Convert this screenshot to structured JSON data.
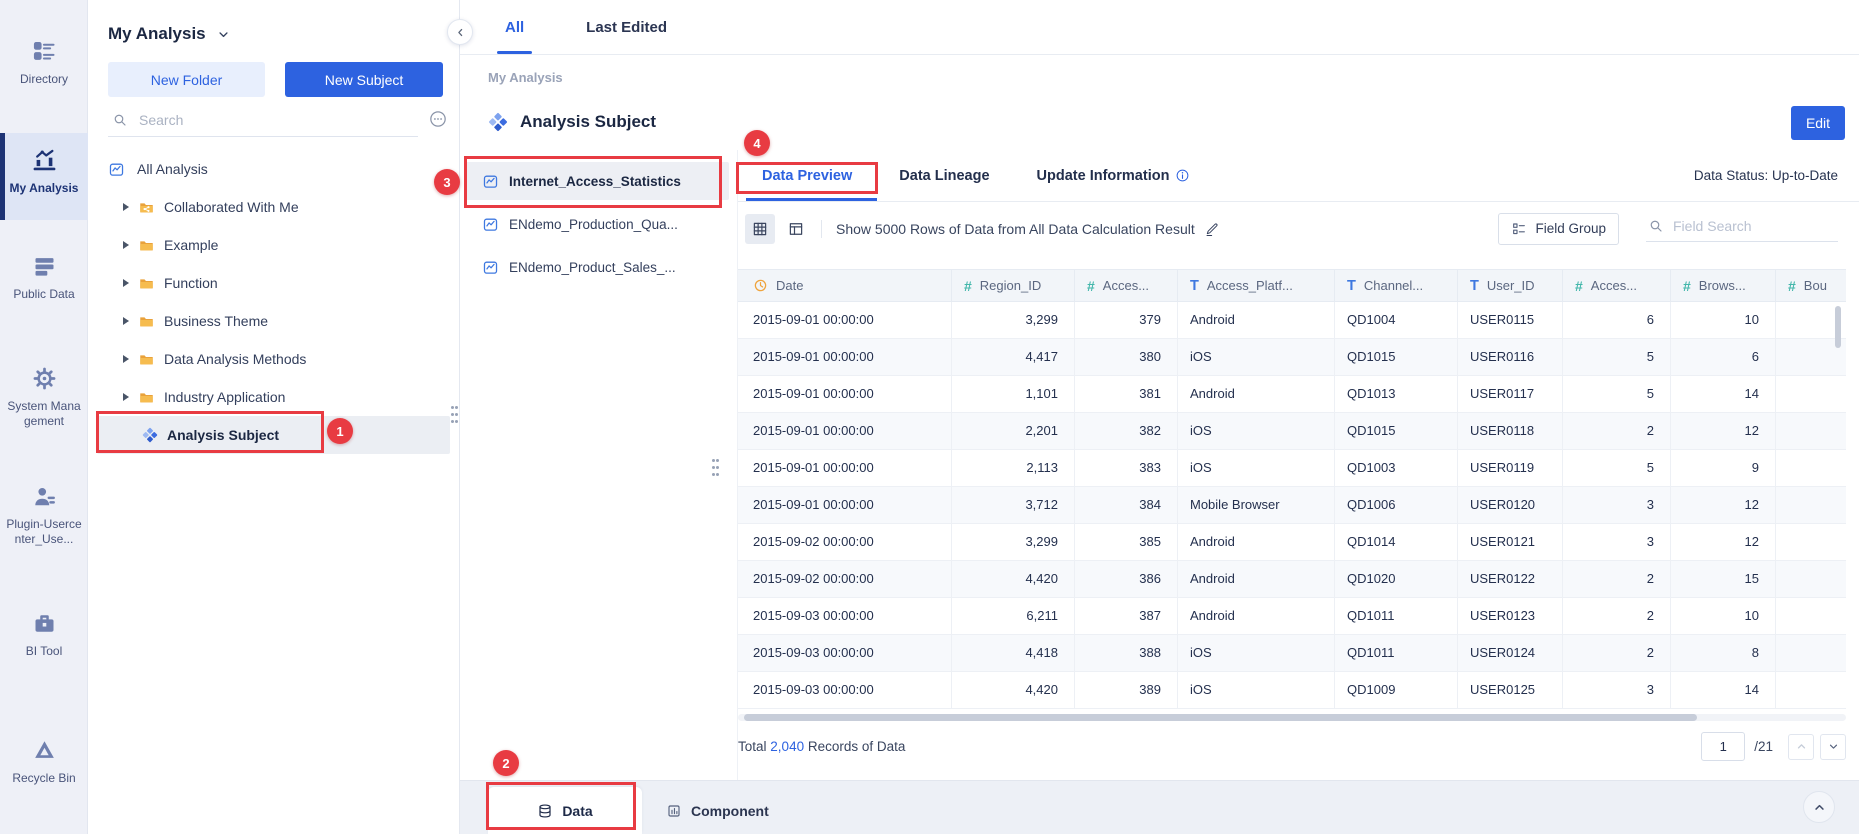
{
  "colors": {
    "accent": "#2d62e0",
    "annotation_red": "#e83b42",
    "sidebar_active_navy": "#1d3375",
    "folder_yellow": "#f3b74a",
    "numeric_field_teal": "#44b7ab",
    "text_field_blue": "#3e78e0",
    "date_field_orange": "#efa43d"
  },
  "annotations": {
    "step1": "1",
    "step2": "2",
    "step3": "3",
    "step4": "4"
  },
  "sidebar": {
    "items": [
      {
        "label": "Directory",
        "icon": "directory-icon",
        "active": false
      },
      {
        "label": "My Analysis",
        "icon": "my-analysis-icon",
        "active": true
      },
      {
        "label": "Public Data",
        "icon": "public-data-icon",
        "active": false
      },
      {
        "label": "System Management",
        "icon": "system-management-icon",
        "active": false
      },
      {
        "label": "Plugin-Usercenter_Use...",
        "icon": "plugin-user-icon",
        "active": false
      },
      {
        "label": "BI Tool",
        "icon": "bi-tool-icon",
        "active": false
      },
      {
        "label": "Recycle Bin",
        "icon": "recycle-bin-icon",
        "active": false
      }
    ]
  },
  "tree_panel": {
    "title": "My Analysis",
    "new_folder_button": "New Folder",
    "new_subject_button": "New Subject",
    "search_placeholder": "Search",
    "root_item": "All Analysis",
    "folders": [
      "Collaborated With Me",
      "Example",
      "Function",
      "Business Theme",
      "Data Analysis Methods",
      "Industry Application"
    ],
    "selected_item": "Analysis Subject"
  },
  "top_tabs": [
    {
      "label": "All",
      "active": true
    },
    {
      "label": "Last Edited",
      "active": false
    }
  ],
  "main": {
    "breadcrumb": "My Analysis",
    "page_title": "Analysis Subject",
    "edit_button": "Edit",
    "subject_list": [
      {
        "label": "Internet_Access_Statistics",
        "selected": true
      },
      {
        "label": "ENdemo_Production_Qua...",
        "selected": false
      },
      {
        "label": "ENdemo_Product_Sales_...",
        "selected": false
      }
    ],
    "detail_tabs": [
      {
        "label": "Data Preview",
        "active": true,
        "info_icon": false
      },
      {
        "label": "Data Lineage",
        "active": false,
        "info_icon": false
      },
      {
        "label": "Update Information",
        "active": false,
        "info_icon": true
      }
    ],
    "data_status": "Data Status: Up-to-Date",
    "toolbar": {
      "show_rows_text": "Show 5000 Rows of Data from All Data Calculation Result",
      "field_group_button": "Field Group",
      "field_search_placeholder": "Field Search"
    },
    "table": {
      "columns": [
        {
          "label": "Date",
          "icon": "clock-icon",
          "align": "left"
        },
        {
          "label": "Region_ID",
          "icon": "hash-icon",
          "align": "right"
        },
        {
          "label": "Acces...",
          "icon": "hash-icon",
          "align": "right"
        },
        {
          "label": "Access_Platf...",
          "icon": "text-icon",
          "align": "left"
        },
        {
          "label": "Channel...",
          "icon": "text-icon",
          "align": "left"
        },
        {
          "label": "User_ID",
          "icon": "text-icon",
          "align": "left"
        },
        {
          "label": "Acces...",
          "icon": "hash-icon",
          "align": "right"
        },
        {
          "label": "Brows...",
          "icon": "hash-icon",
          "align": "right"
        },
        {
          "label": "Bou",
          "icon": "hash-icon",
          "align": "right"
        }
      ],
      "rows": [
        [
          "2015-09-01 00:00:00",
          "3,299",
          "379",
          "Android",
          "QD1004",
          "USER0115",
          "6",
          "10"
        ],
        [
          "2015-09-01 00:00:00",
          "4,417",
          "380",
          "iOS",
          "QD1015",
          "USER0116",
          "5",
          "6"
        ],
        [
          "2015-09-01 00:00:00",
          "1,101",
          "381",
          "Android",
          "QD1013",
          "USER0117",
          "5",
          "14"
        ],
        [
          "2015-09-01 00:00:00",
          "2,201",
          "382",
          "iOS",
          "QD1015",
          "USER0118",
          "2",
          "12"
        ],
        [
          "2015-09-01 00:00:00",
          "2,113",
          "383",
          "iOS",
          "QD1003",
          "USER0119",
          "5",
          "9"
        ],
        [
          "2015-09-01 00:00:00",
          "3,712",
          "384",
          "Mobile Browser",
          "QD1006",
          "USER0120",
          "3",
          "12"
        ],
        [
          "2015-09-02 00:00:00",
          "3,299",
          "385",
          "Android",
          "QD1014",
          "USER0121",
          "3",
          "12"
        ],
        [
          "2015-09-02 00:00:00",
          "4,420",
          "386",
          "Android",
          "QD1020",
          "USER0122",
          "2",
          "15"
        ],
        [
          "2015-09-03 00:00:00",
          "6,211",
          "387",
          "Android",
          "QD1011",
          "USER0123",
          "2",
          "10"
        ],
        [
          "2015-09-03 00:00:00",
          "4,418",
          "388",
          "iOS",
          "QD1011",
          "USER0124",
          "2",
          "8"
        ],
        [
          "2015-09-03 00:00:00",
          "4,420",
          "389",
          "iOS",
          "QD1009",
          "USER0125",
          "3",
          "14"
        ]
      ]
    },
    "footer": {
      "total_prefix": "Total",
      "total_count": "2,040",
      "total_suffix": "Records of Data",
      "page_value": "1",
      "page_total": "/21"
    }
  },
  "bottom_bar": {
    "data_tab": "Data",
    "component_tab": "Component"
  }
}
